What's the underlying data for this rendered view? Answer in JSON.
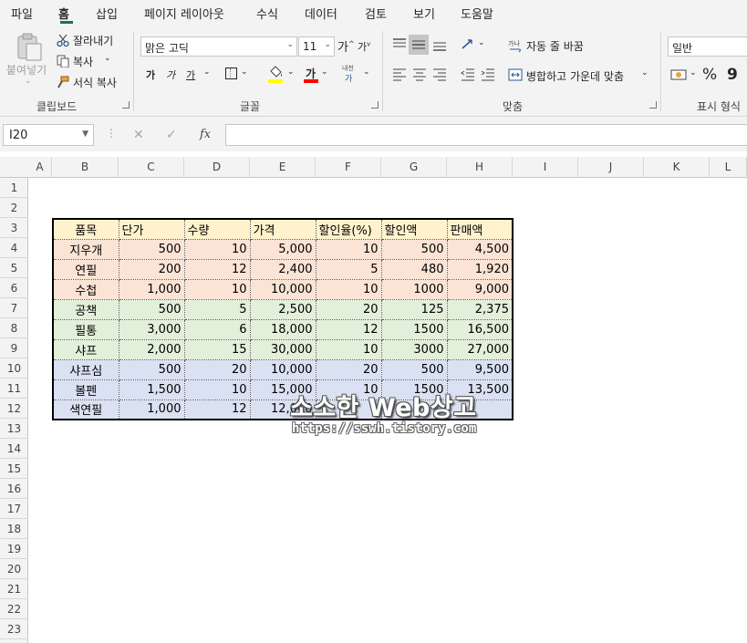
{
  "menu_tabs": [
    "파일",
    "홈",
    "삽입",
    "페이지 레이아웃",
    "수식",
    "데이터",
    "검토",
    "보기",
    "도움말"
  ],
  "active_tab": "홈",
  "ribbon": {
    "clipboard": {
      "paste_label": "붙여넣기",
      "cut_label": "잘라내기",
      "copy_label": "복사",
      "format_painter_label": "서식 복사",
      "group_label": "클립보드"
    },
    "font": {
      "font_name": "맑은 고딕",
      "font_size": "11",
      "grow_glyph": "가",
      "shrink_glyph": "가",
      "bold_glyph": "가",
      "italic_glyph": "가",
      "underline_glyph": "가",
      "font_color_glyph": "가",
      "fill_color": "#ffff00",
      "font_color": "#ff0000",
      "phonetic_top": "내천",
      "phonetic_bottom": "가",
      "group_label": "글꼴"
    },
    "alignment": {
      "wrap_text_label": "자동 줄 바꿈",
      "merge_center_label": "병합하고 가운데 맞춤",
      "group_label": "맞춤"
    },
    "number": {
      "format_value": "일반",
      "percent_glyph": "%",
      "comma_glyph": "9",
      "group_label": "표시 형식"
    }
  },
  "formula_bar": {
    "name_box": "I20",
    "cancel_glyph": "✕",
    "enter_glyph": "✓",
    "fx_glyph": "fx",
    "formula_value": ""
  },
  "columns": [
    "A",
    "B",
    "C",
    "D",
    "E",
    "F",
    "G",
    "H",
    "I",
    "J",
    "K",
    "L"
  ],
  "rows": [
    "1",
    "2",
    "3",
    "4",
    "5",
    "6",
    "7",
    "8",
    "9",
    "10",
    "11",
    "12",
    "13",
    "14",
    "15",
    "16",
    "17",
    "18",
    "19",
    "20",
    "21",
    "22",
    "23"
  ],
  "table": {
    "headers": [
      "품목",
      "단가",
      "수량",
      "가격",
      "할인율(%)",
      "할인액",
      "판매액"
    ],
    "rows": [
      {
        "group": 1,
        "cells": [
          "지우개",
          "500",
          "10",
          "5,000",
          "10",
          "500",
          "4,500"
        ]
      },
      {
        "group": 1,
        "cells": [
          "연필",
          "200",
          "12",
          "2,400",
          "5",
          "480",
          "1,920"
        ]
      },
      {
        "group": 1,
        "cells": [
          "수첩",
          "1,000",
          "10",
          "10,000",
          "10",
          "1000",
          "9,000"
        ]
      },
      {
        "group": 2,
        "cells": [
          "공책",
          "500",
          "5",
          "2,500",
          "20",
          "125",
          "2,375"
        ]
      },
      {
        "group": 2,
        "cells": [
          "필통",
          "3,000",
          "6",
          "18,000",
          "12",
          "1500",
          "16,500"
        ]
      },
      {
        "group": 2,
        "cells": [
          "샤프",
          "2,000",
          "15",
          "30,000",
          "10",
          "3000",
          "27,000"
        ]
      },
      {
        "group": 3,
        "cells": [
          "샤프심",
          "500",
          "20",
          "10,000",
          "20",
          "500",
          "9,500"
        ]
      },
      {
        "group": 3,
        "cells": [
          "볼펜",
          "1,500",
          "10",
          "15,000",
          "10",
          "1500",
          "13,500"
        ]
      },
      {
        "group": 3,
        "cells": [
          "색연필",
          "1,000",
          "12",
          "12,000",
          "",
          "",
          ""
        ]
      }
    ],
    "colors": {
      "header": "#fff2cc",
      "group1": "#fbe4d5",
      "group2": "#e2efda",
      "group3": "#d9e1f2"
    }
  },
  "watermark": {
    "title": "소소한 Web상고",
    "url": "https://sswh.tistory.com"
  },
  "accent_color": "#217346"
}
